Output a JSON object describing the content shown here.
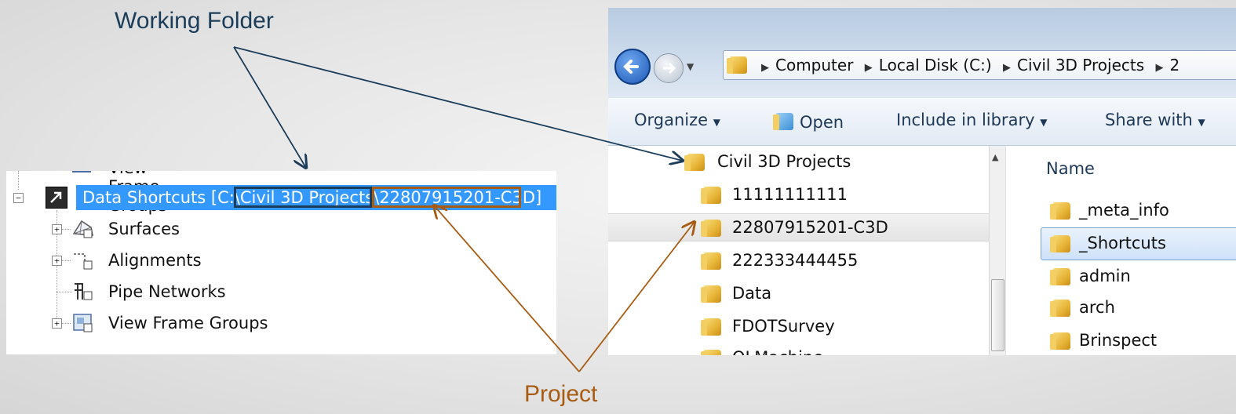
{
  "callouts": {
    "working_folder": "Working Folder",
    "project": "Project"
  },
  "tree": {
    "partial_top": "View Frame Groups",
    "data_shortcuts_prefix": "Data Shortcuts [C:\\",
    "working_folder_text": "Civil 3D Projects",
    "project_text": "\\22807915201-C3D",
    "data_shortcuts_suffix": "]",
    "children": [
      {
        "label": "Surfaces",
        "icon": "surface-icon"
      },
      {
        "label": "Alignments",
        "icon": "alignment-icon"
      },
      {
        "label": "Pipe Networks",
        "icon": "pipe-network-icon"
      },
      {
        "label": "View Frame Groups",
        "icon": "view-frame-icon"
      }
    ]
  },
  "explorer": {
    "breadcrumb": [
      "Computer",
      "Local Disk (C:)",
      "Civil 3D Projects",
      "2"
    ],
    "toolbar": {
      "organize": "Organize",
      "open": "Open",
      "include_in_library": "Include in library",
      "share_with": "Share with"
    },
    "nav_items": [
      "Civil 3D Projects",
      "11111111111",
      "22807915201-C3D",
      "222333444455",
      "Data",
      "FDOTSurvey",
      "OLMachine"
    ],
    "content_header": "Name",
    "content_items": [
      "_meta_info",
      "_Shortcuts",
      "admin",
      "arch",
      "Brinspect"
    ]
  },
  "colors": {
    "working_folder": "#1b3d5a",
    "project": "#a85c12",
    "selection_blue": "#3399ff"
  }
}
